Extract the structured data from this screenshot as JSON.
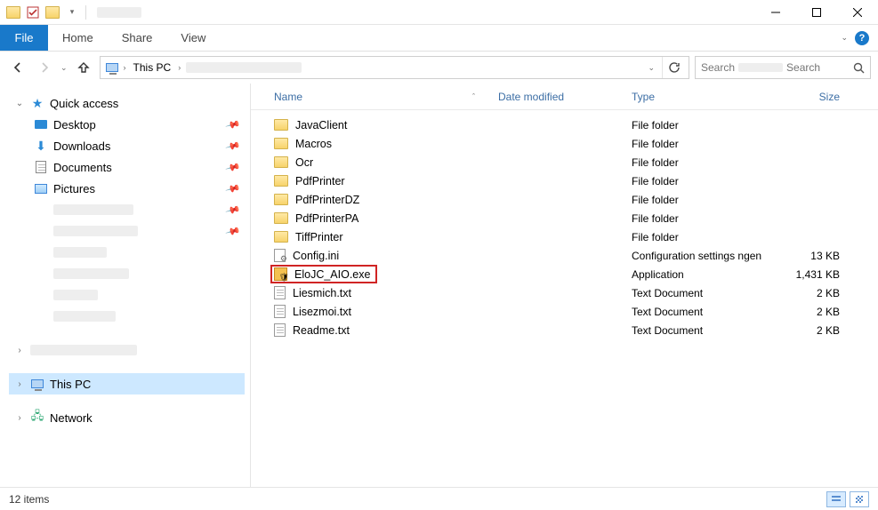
{
  "ribbon": {
    "file": "File",
    "tabs": [
      "Home",
      "Share",
      "View"
    ]
  },
  "address": {
    "breadcrumb": "This PC"
  },
  "search": {
    "placeholder": "Search"
  },
  "nav": {
    "quick_access": "Quick access",
    "items": [
      {
        "label": "Desktop",
        "icon": "desktop"
      },
      {
        "label": "Downloads",
        "icon": "download"
      },
      {
        "label": "Documents",
        "icon": "doc"
      },
      {
        "label": "Pictures",
        "icon": "pic"
      }
    ],
    "this_pc": "This PC",
    "network": "Network"
  },
  "columns": {
    "name": "Name",
    "date": "Date modified",
    "type": "Type",
    "size": "Size"
  },
  "files": [
    {
      "name": "JavaClient",
      "icon": "folder",
      "type": "File folder",
      "size": ""
    },
    {
      "name": "Macros",
      "icon": "folder",
      "type": "File folder",
      "size": ""
    },
    {
      "name": "Ocr",
      "icon": "folder",
      "type": "File folder",
      "size": ""
    },
    {
      "name": "PdfPrinter",
      "icon": "folder",
      "type": "File folder",
      "size": ""
    },
    {
      "name": "PdfPrinterDZ",
      "icon": "folder",
      "type": "File folder",
      "size": ""
    },
    {
      "name": "PdfPrinterPA",
      "icon": "folder",
      "type": "File folder",
      "size": ""
    },
    {
      "name": "TiffPrinter",
      "icon": "folder",
      "type": "File folder",
      "size": ""
    },
    {
      "name": "Config.ini",
      "icon": "ini",
      "type": "Configuration settings ngen",
      "size": "13 KB"
    },
    {
      "name": "EloJC_AIO.exe",
      "icon": "exe",
      "type": "Application",
      "size": "1,431 KB",
      "highlight": true
    },
    {
      "name": "Liesmich.txt",
      "icon": "txt",
      "type": "Text Document",
      "size": "2 KB"
    },
    {
      "name": "Lisezmoi.txt",
      "icon": "txt",
      "type": "Text Document",
      "size": "2 KB"
    },
    {
      "name": "Readme.txt",
      "icon": "txt",
      "type": "Text Document",
      "size": "2 KB"
    }
  ],
  "status": {
    "count": "12 items"
  }
}
